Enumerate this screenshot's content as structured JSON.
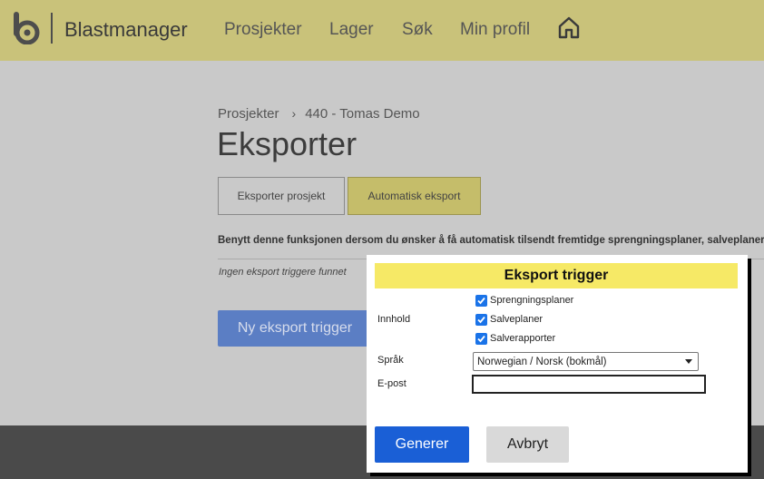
{
  "header": {
    "brand": "Blastmanager",
    "nav": [
      "Prosjekter",
      "Lager",
      "Søk",
      "Min profil"
    ],
    "home_icon": "home-icon",
    "logo_icon": "blastmanager-logo-icon"
  },
  "breadcrumb": {
    "items": [
      "Prosjekter",
      "440 - Tomas Demo"
    ],
    "separator_icon": "chevron-right-icon"
  },
  "page": {
    "title": "Eksporter",
    "tabs": [
      "Eksporter prosjekt",
      "Automatisk eksport"
    ],
    "active_tab": "Automatisk eksport",
    "description": "Benytt denne funksjonen dersom du ønsker å få automatisk tilsendt fremtidge sprengningsplaner, salveplaner",
    "empty_note": "Ingen eksport triggere funnet",
    "new_button": "Ny eksport trigger"
  },
  "modal": {
    "title": "Eksport trigger",
    "content_label": "Innhold",
    "checkboxes": [
      {
        "label": "Sprengningsplaner",
        "checked": true
      },
      {
        "label": "Salveplaner",
        "checked": true
      },
      {
        "label": "Salverapporter",
        "checked": true
      }
    ],
    "language_label": "Språk",
    "language_value": "Norwegian / Norsk (bokmål)",
    "email_label": "E-post",
    "email_value": "",
    "generate_button": "Generer",
    "cancel_button": "Avbryt"
  },
  "colors": {
    "header_bg": "#c9c27a",
    "active_tab_bg": "#c5bd6a",
    "modal_title_bg": "#f6e966",
    "primary_button": "#1a5fd6",
    "checkbox_accent": "#1a73e8"
  }
}
